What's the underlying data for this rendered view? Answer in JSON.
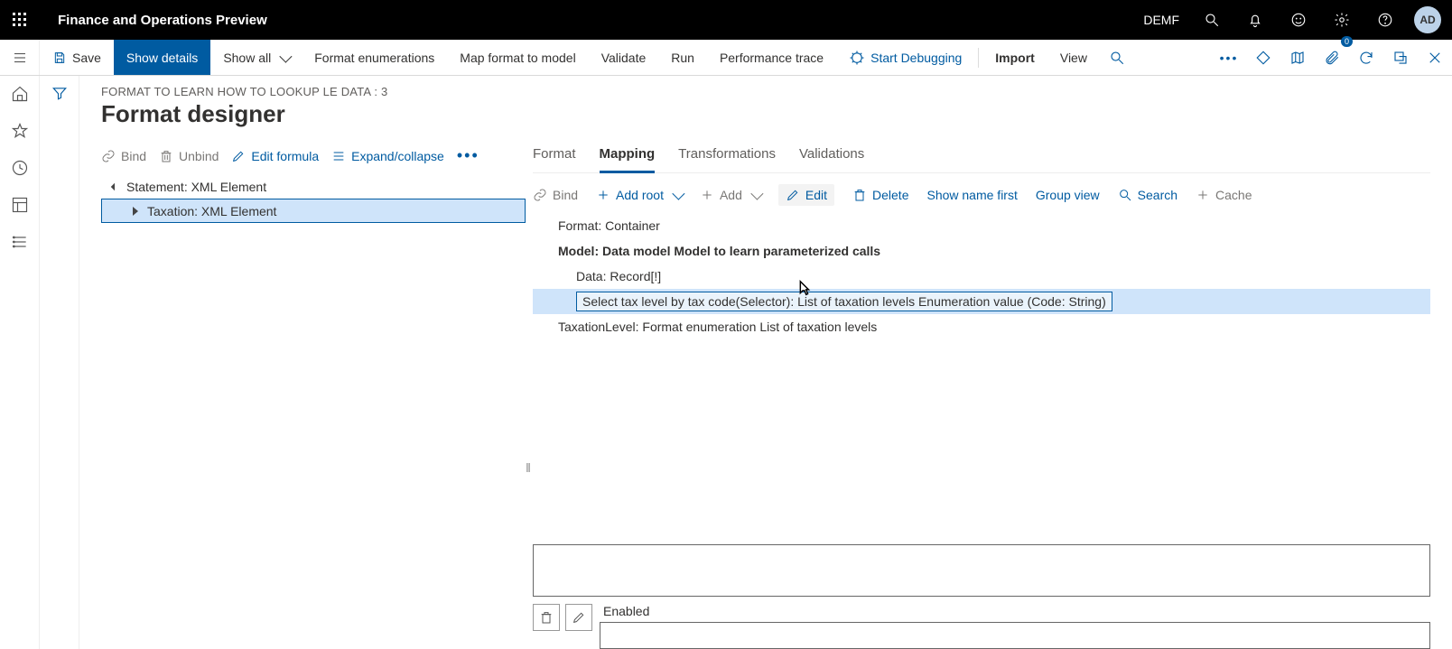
{
  "titlebar": {
    "app_title": "Finance and Operations Preview",
    "environment": "DEMF",
    "avatar_initials": "AD"
  },
  "cmdbar": {
    "save": "Save",
    "show_details": "Show details",
    "show_all": "Show all",
    "format_enums": "Format enumerations",
    "map_format": "Map format to model",
    "validate": "Validate",
    "run": "Run",
    "perf_trace": "Performance trace",
    "start_debug": "Start Debugging",
    "import": "Import",
    "view": "View"
  },
  "breadcrumb": "FORMAT TO LEARN HOW TO LOOKUP LE DATA : 3",
  "page_title": "Format designer",
  "left_toolbar": {
    "bind": "Bind",
    "unbind": "Unbind",
    "edit_formula": "Edit formula",
    "expand_collapse": "Expand/collapse"
  },
  "left_tree": {
    "n0": "Statement: XML Element",
    "n1": "Taxation: XML Element"
  },
  "tabs": {
    "format": "Format",
    "mapping": "Mapping",
    "transformations": "Transformations",
    "validations": "Validations"
  },
  "right_toolbar": {
    "bind": "Bind",
    "add_root": "Add root",
    "add": "Add",
    "edit": "Edit",
    "delete": "Delete",
    "show_name_first": "Show name first",
    "group_view": "Group view",
    "search": "Search",
    "cache": "Cache"
  },
  "right_tree": {
    "n0": "Format: Container",
    "n1": "Model: Data model Model to learn parameterized calls",
    "n2": "Data: Record[!]",
    "n3": "Select tax level by tax code(Selector): List of taxation levels Enumeration value (Code: String)",
    "n4": "TaxationLevel: Format enumeration List of taxation levels"
  },
  "props": {
    "enabled_label": "Enabled"
  }
}
